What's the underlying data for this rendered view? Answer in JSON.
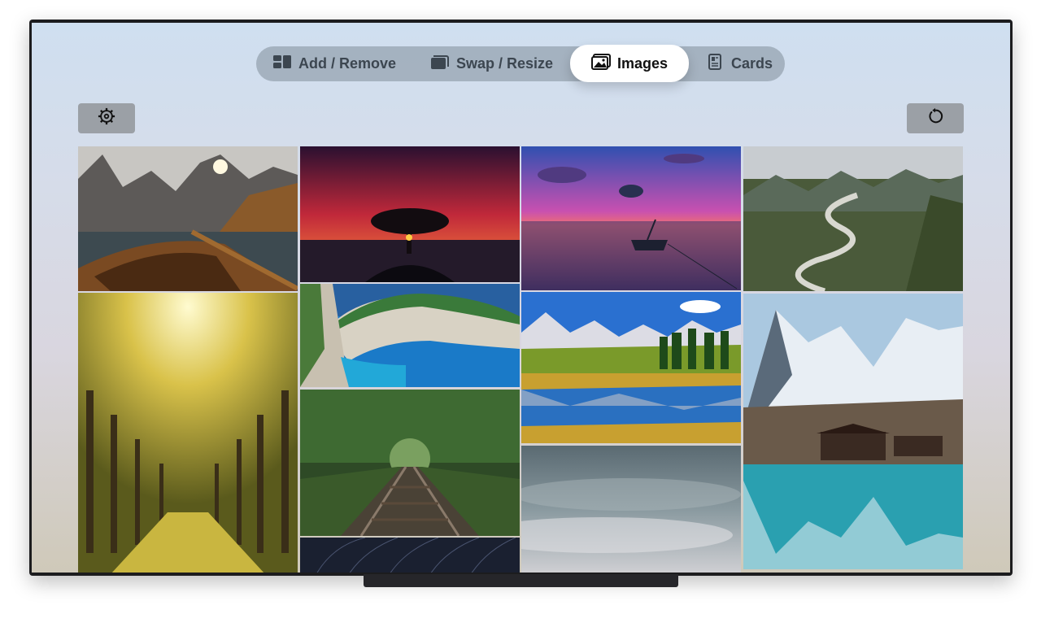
{
  "tabs": [
    {
      "label": "Add / Remove",
      "icon": "layout-grid-icon",
      "selected": false
    },
    {
      "label": "Swap / Resize",
      "icon": "stacked-cards-icon",
      "selected": false
    },
    {
      "label": "Images",
      "icon": "photo-icon",
      "selected": true
    },
    {
      "label": "Cards",
      "icon": "contact-card-icon",
      "selected": false
    }
  ],
  "toolbar": {
    "settings_icon": "gear-icon",
    "refresh_icon": "refresh-icon"
  },
  "gallery": {
    "images": [
      "mountain-lake-rowboat",
      "tree-sunset-red-sky",
      "lake-boat-purple-sunset",
      "river-valley-mountains",
      "yellow-forest-sun-path",
      "cliff-beach-turquoise-sea",
      "alpine-meadow-reflection-lake",
      "forest-railway-tracks",
      "snowy-peaks-cabin-lake",
      "grey-cloud-sky",
      "star-trail-night-sky"
    ]
  },
  "colors": {
    "selected_tab_bg": "#ffffff",
    "tab_bar_bg": "#7a8792",
    "tool_button_bg": "#9ba0a6",
    "tv_frame": "#1c1c1e"
  }
}
